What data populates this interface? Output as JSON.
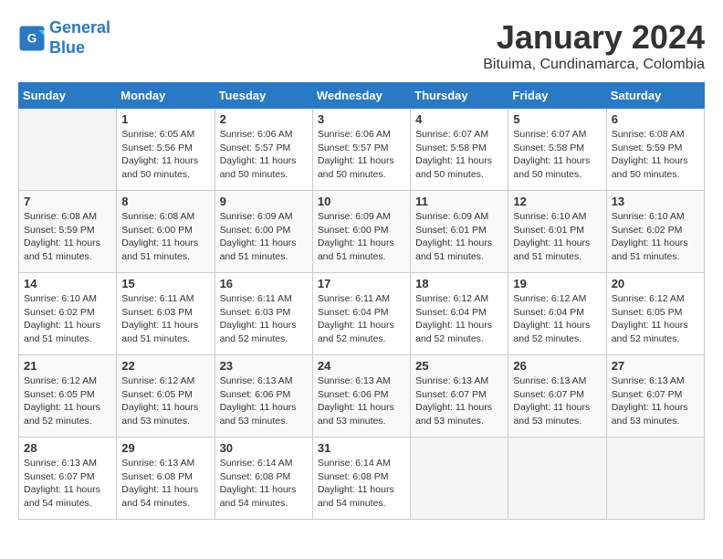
{
  "logo": {
    "line1": "General",
    "line2": "Blue"
  },
  "title": "January 2024",
  "location": "Bituima, Cundinamarca, Colombia",
  "headers": [
    "Sunday",
    "Monday",
    "Tuesday",
    "Wednesday",
    "Thursday",
    "Friday",
    "Saturday"
  ],
  "weeks": [
    [
      {
        "day": "",
        "info": ""
      },
      {
        "day": "1",
        "info": "Sunrise: 6:05 AM\nSunset: 5:56 PM\nDaylight: 11 hours\nand 50 minutes."
      },
      {
        "day": "2",
        "info": "Sunrise: 6:06 AM\nSunset: 5:57 PM\nDaylight: 11 hours\nand 50 minutes."
      },
      {
        "day": "3",
        "info": "Sunrise: 6:06 AM\nSunset: 5:57 PM\nDaylight: 11 hours\nand 50 minutes."
      },
      {
        "day": "4",
        "info": "Sunrise: 6:07 AM\nSunset: 5:58 PM\nDaylight: 11 hours\nand 50 minutes."
      },
      {
        "day": "5",
        "info": "Sunrise: 6:07 AM\nSunset: 5:58 PM\nDaylight: 11 hours\nand 50 minutes."
      },
      {
        "day": "6",
        "info": "Sunrise: 6:08 AM\nSunset: 5:59 PM\nDaylight: 11 hours\nand 50 minutes."
      }
    ],
    [
      {
        "day": "7",
        "info": "Sunrise: 6:08 AM\nSunset: 5:59 PM\nDaylight: 11 hours\nand 51 minutes."
      },
      {
        "day": "8",
        "info": "Sunrise: 6:08 AM\nSunset: 6:00 PM\nDaylight: 11 hours\nand 51 minutes."
      },
      {
        "day": "9",
        "info": "Sunrise: 6:09 AM\nSunset: 6:00 PM\nDaylight: 11 hours\nand 51 minutes."
      },
      {
        "day": "10",
        "info": "Sunrise: 6:09 AM\nSunset: 6:00 PM\nDaylight: 11 hours\nand 51 minutes."
      },
      {
        "day": "11",
        "info": "Sunrise: 6:09 AM\nSunset: 6:01 PM\nDaylight: 11 hours\nand 51 minutes."
      },
      {
        "day": "12",
        "info": "Sunrise: 6:10 AM\nSunset: 6:01 PM\nDaylight: 11 hours\nand 51 minutes."
      },
      {
        "day": "13",
        "info": "Sunrise: 6:10 AM\nSunset: 6:02 PM\nDaylight: 11 hours\nand 51 minutes."
      }
    ],
    [
      {
        "day": "14",
        "info": "Sunrise: 6:10 AM\nSunset: 6:02 PM\nDaylight: 11 hours\nand 51 minutes."
      },
      {
        "day": "15",
        "info": "Sunrise: 6:11 AM\nSunset: 6:03 PM\nDaylight: 11 hours\nand 51 minutes."
      },
      {
        "day": "16",
        "info": "Sunrise: 6:11 AM\nSunset: 6:03 PM\nDaylight: 11 hours\nand 52 minutes."
      },
      {
        "day": "17",
        "info": "Sunrise: 6:11 AM\nSunset: 6:04 PM\nDaylight: 11 hours\nand 52 minutes."
      },
      {
        "day": "18",
        "info": "Sunrise: 6:12 AM\nSunset: 6:04 PM\nDaylight: 11 hours\nand 52 minutes."
      },
      {
        "day": "19",
        "info": "Sunrise: 6:12 AM\nSunset: 6:04 PM\nDaylight: 11 hours\nand 52 minutes."
      },
      {
        "day": "20",
        "info": "Sunrise: 6:12 AM\nSunset: 6:05 PM\nDaylight: 11 hours\nand 52 minutes."
      }
    ],
    [
      {
        "day": "21",
        "info": "Sunrise: 6:12 AM\nSunset: 6:05 PM\nDaylight: 11 hours\nand 52 minutes."
      },
      {
        "day": "22",
        "info": "Sunrise: 6:12 AM\nSunset: 6:05 PM\nDaylight: 11 hours\nand 53 minutes."
      },
      {
        "day": "23",
        "info": "Sunrise: 6:13 AM\nSunset: 6:06 PM\nDaylight: 11 hours\nand 53 minutes."
      },
      {
        "day": "24",
        "info": "Sunrise: 6:13 AM\nSunset: 6:06 PM\nDaylight: 11 hours\nand 53 minutes."
      },
      {
        "day": "25",
        "info": "Sunrise: 6:13 AM\nSunset: 6:07 PM\nDaylight: 11 hours\nand 53 minutes."
      },
      {
        "day": "26",
        "info": "Sunrise: 6:13 AM\nSunset: 6:07 PM\nDaylight: 11 hours\nand 53 minutes."
      },
      {
        "day": "27",
        "info": "Sunrise: 6:13 AM\nSunset: 6:07 PM\nDaylight: 11 hours\nand 53 minutes."
      }
    ],
    [
      {
        "day": "28",
        "info": "Sunrise: 6:13 AM\nSunset: 6:07 PM\nDaylight: 11 hours\nand 54 minutes."
      },
      {
        "day": "29",
        "info": "Sunrise: 6:13 AM\nSunset: 6:08 PM\nDaylight: 11 hours\nand 54 minutes."
      },
      {
        "day": "30",
        "info": "Sunrise: 6:14 AM\nSunset: 6:08 PM\nDaylight: 11 hours\nand 54 minutes."
      },
      {
        "day": "31",
        "info": "Sunrise: 6:14 AM\nSunset: 6:08 PM\nDaylight: 11 hours\nand 54 minutes."
      },
      {
        "day": "",
        "info": ""
      },
      {
        "day": "",
        "info": ""
      },
      {
        "day": "",
        "info": ""
      }
    ]
  ]
}
